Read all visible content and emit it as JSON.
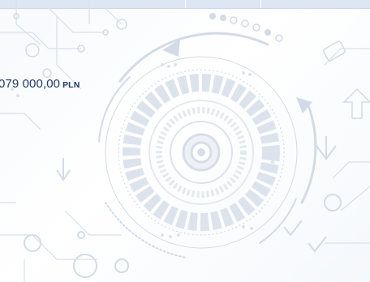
{
  "summary": {
    "amount_value": "079 000,00",
    "amount_currency": "PLN"
  },
  "icons": {
    "background": "circuit-gear-decoration-icon"
  },
  "colors": {
    "amount_text": "#1e3a66",
    "header_bar": "#dfe6f3",
    "decoration": "#d6dde8"
  }
}
